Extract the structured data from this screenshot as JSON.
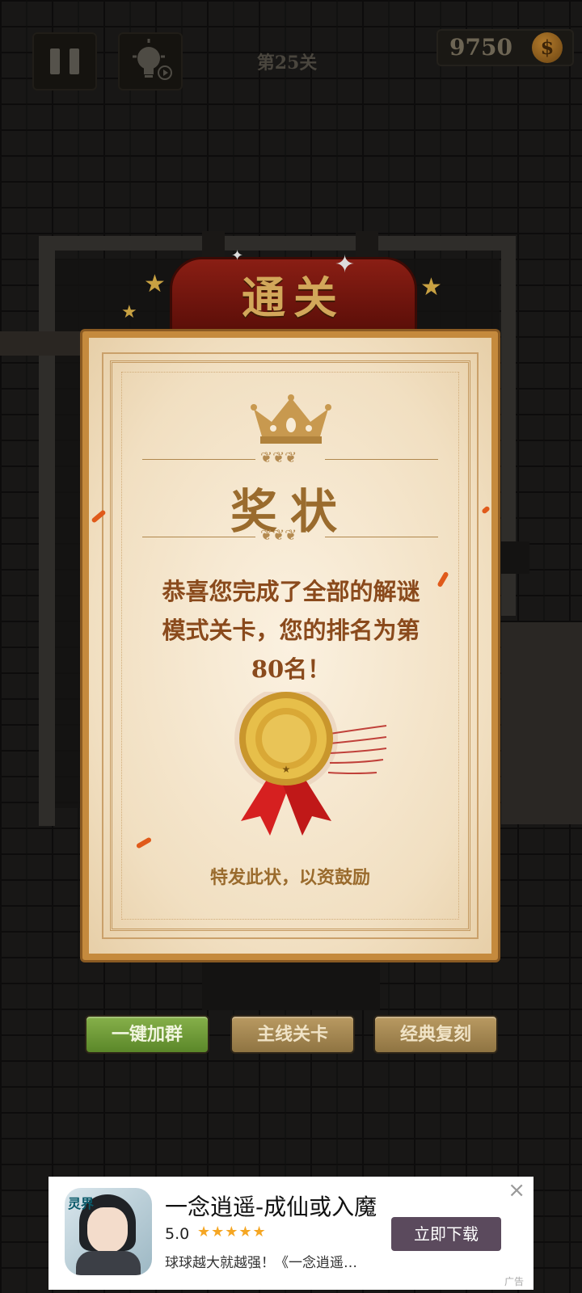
{
  "top_bar": {
    "level_label": "第25关",
    "coins": "9750",
    "coin_symbol": "$"
  },
  "banner": {
    "title": "通关"
  },
  "certificate": {
    "title": "奖状",
    "message": "恭喜您完成了全部的解谜模式关卡，您的排名为第80名！",
    "footer": "特发此状，以资鼓励"
  },
  "buttons": {
    "join_group": "一键加群",
    "main_levels": "主线关卡",
    "classic_remake": "经典复刻"
  },
  "ad": {
    "icon_text": "灵界",
    "title": "一念逍遥-成仙或入魔",
    "rating": "5.0",
    "stars": "★★★★★",
    "description": "球球越大就越强！《一念逍遥…",
    "cta": "立即下载",
    "close": "×",
    "tag": "广告"
  }
}
